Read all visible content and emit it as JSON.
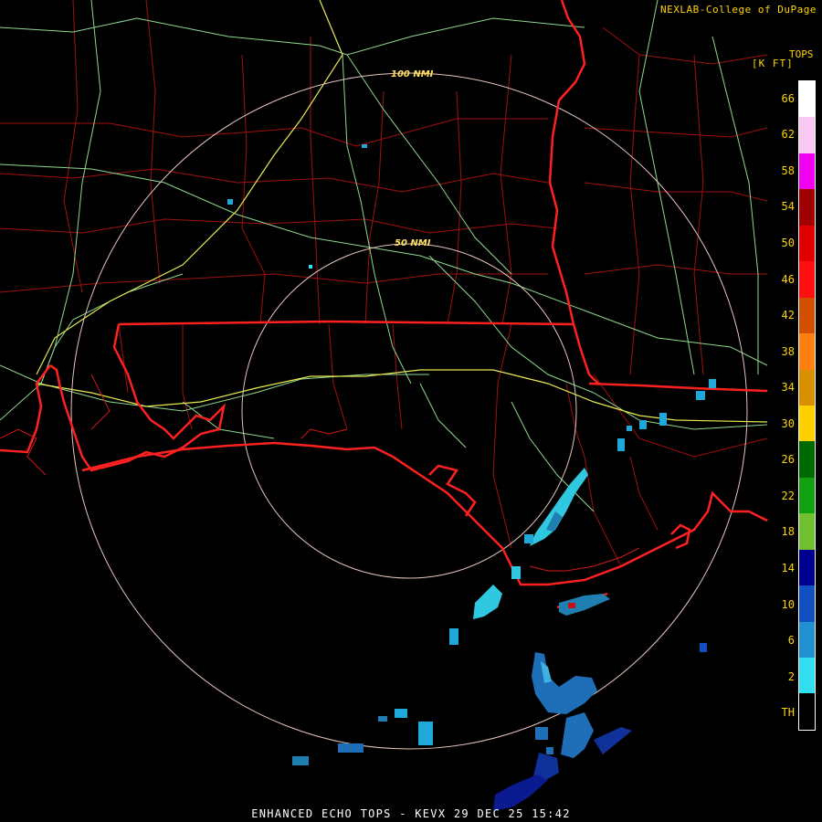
{
  "header": {
    "source": "NEXLAB-College of DuPage"
  },
  "product": {
    "footer": "ENHANCED ECHO TOPS - KEVX 29 DEC 25 15:42"
  },
  "rings": [
    {
      "label": "100 NMI"
    },
    {
      "label": "50 NMI"
    }
  ],
  "legend": {
    "title": "TOPS",
    "units": "[K FT]",
    "labels": [
      "66",
      "62",
      "58",
      "54",
      "50",
      "46",
      "42",
      "38",
      "34",
      "30",
      "26",
      "22",
      "18",
      "14",
      "10",
      "6",
      "2",
      "TH"
    ],
    "swatches": [
      "#ffffff",
      "#f8c8f0",
      "#f000f0",
      "#a00000",
      "#e00000",
      "#ff1010",
      "#d05000",
      "#ff8010",
      "#d89000",
      "#ffd000",
      "#006a00",
      "#10a010",
      "#70c030",
      "#000090",
      "#1050c0",
      "#2090d0",
      "#30e0f0",
      "#000000"
    ]
  },
  "colors": {
    "state_border": "#ff2020",
    "county_border": "#b01010",
    "highway_interstate": "#e8e850",
    "highway_other": "#90d890",
    "range_ring": "#e8c8c0"
  }
}
